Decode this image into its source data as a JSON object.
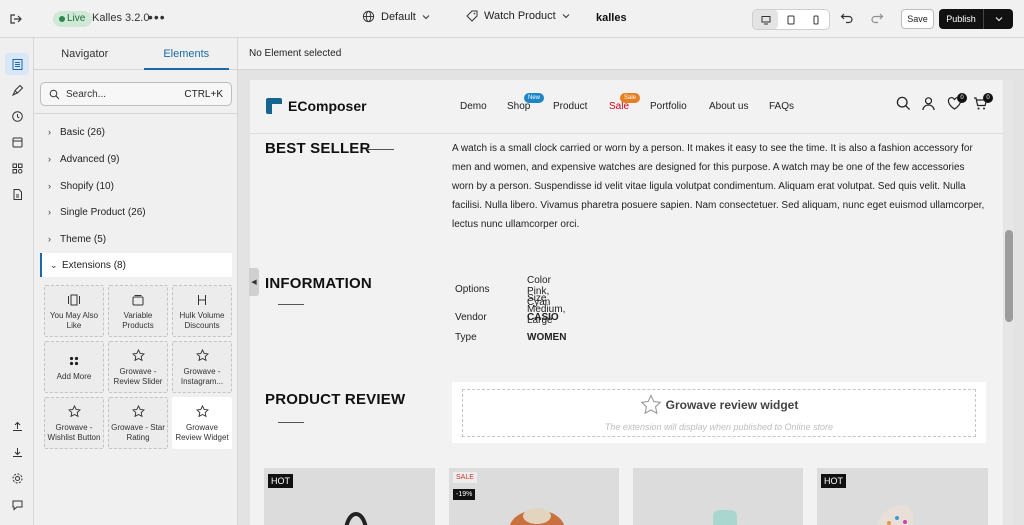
{
  "topbar": {
    "live_label": "Live",
    "theme_name": "Kalles 3.2.0",
    "more": "•••",
    "language": "Default",
    "page": "Watch Product",
    "brand": "kalles",
    "save_label": "Save",
    "publish_label": "Publish"
  },
  "panel": {
    "tabs": [
      "Navigator",
      "Elements"
    ],
    "search_placeholder": "Search...",
    "search_shortcut": "CTRL+K",
    "categories": [
      {
        "label": "Basic (26)"
      },
      {
        "label": "Advanced (9)"
      },
      {
        "label": "Shopify (10)"
      },
      {
        "label": "Single Product (26)"
      },
      {
        "label": "Theme (5)"
      },
      {
        "label": "Extensions (8)"
      }
    ],
    "extensions": [
      {
        "line1": "You May Also",
        "line2": "Like",
        "icon": "layout-icon"
      },
      {
        "line1": "Variable",
        "line2": "Products",
        "icon": "stack-icon"
      },
      {
        "line1": "Hulk Volume",
        "line2": "Discounts",
        "icon": "h-icon"
      },
      {
        "line1": "Add More",
        "line2": "",
        "icon": "grid-dots-icon"
      },
      {
        "line1": "Growave -",
        "line2": "Review Slider",
        "icon": "star-icon"
      },
      {
        "line1": "Growave -",
        "line2": "Instagram...",
        "icon": "star-icon"
      },
      {
        "line1": "Growave -",
        "line2": "Wishlist Button",
        "icon": "star-icon"
      },
      {
        "line1": "Growave - Star",
        "line2": "Rating",
        "icon": "star-icon"
      },
      {
        "line1": "Growave",
        "line2": "Review Widget",
        "icon": "star-icon"
      }
    ]
  },
  "canvas": {
    "status": "No Element selected"
  },
  "store": {
    "logo": "EComposer",
    "nav": [
      "Demo",
      "Shop",
      "Product",
      "Sale",
      "Portfolio",
      "About us",
      "FAQs"
    ],
    "badge_new": "New",
    "badge_sale": "Sale",
    "wishlist_count": "0",
    "cart_count": "0",
    "best_seller_title": "BEST SELLER",
    "description": "A watch is a small clock carried or worn by a person. It makes it easy to see the time. It is also a fashion accessory for men and women, and expensive watches are designed for this purpose. A watch may be one of the few accessories worn by a person. Suspendisse id velit vitae ligula volutpat condimentum. Aliquam erat volutpat. Sed quis velit. Nulla facilisi. Nulla libero. Vivamus pharetra posuere sapien. Nam consectetuer. Sed aliquam, nunc eget euismod ullamcorper, lectus nunc ullamcorper orci.",
    "information_title": "INFORMATION",
    "info": {
      "options_key": "Options",
      "options_val1": "Color Pink, Cyan",
      "options_val2": "Size Medium, Large",
      "vendor_key": "Vendor",
      "vendor_val": "CASIO",
      "type_key": "Type",
      "type_val": "WOMEN"
    },
    "review_title": "PRODUCT REVIEW",
    "widget_title": "Growave review widget",
    "widget_sub": "The extension will display when published to Online store",
    "product_tags": {
      "p1": "HOT",
      "p2_sale": "SALE",
      "p2_pct": "-19%",
      "p4": "HOT"
    }
  }
}
